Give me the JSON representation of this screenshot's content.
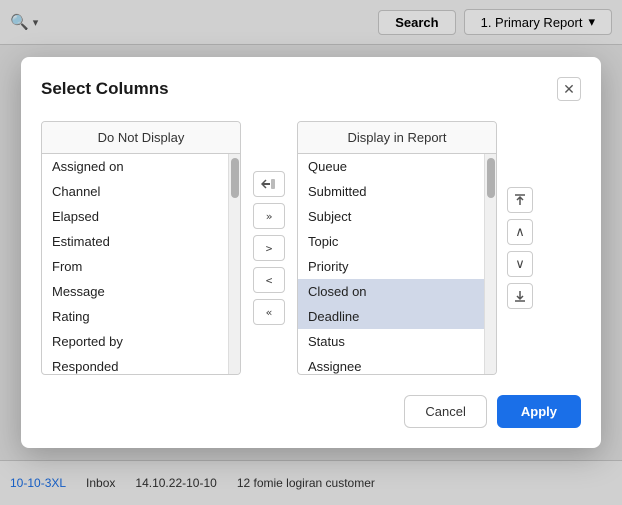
{
  "toolbar": {
    "search_label": "Search",
    "report_label": "1. Primary Report",
    "search_chevron": "⌄"
  },
  "bottom_bar": {
    "item1": "10-10-3XL",
    "item2": "Inbox",
    "item3": "14.10.22-10-10",
    "item4": "12 fomie logiran customer"
  },
  "modal": {
    "title": "Select Columns",
    "left_panel": {
      "header": "Do Not Display",
      "items": [
        {
          "label": "Assigned on",
          "selected": false
        },
        {
          "label": "Channel",
          "selected": false
        },
        {
          "label": "Elapsed",
          "selected": false
        },
        {
          "label": "Estimated",
          "selected": false
        },
        {
          "label": "From",
          "selected": false
        },
        {
          "label": "Message",
          "selected": false
        },
        {
          "label": "Rating",
          "selected": false
        },
        {
          "label": "Reported by",
          "selected": false
        },
        {
          "label": "Responded",
          "selected": false
        }
      ]
    },
    "right_panel": {
      "header": "Display in Report",
      "items": [
        {
          "label": "Queue",
          "selected": false
        },
        {
          "label": "Submitted",
          "selected": false
        },
        {
          "label": "Subject",
          "selected": false
        },
        {
          "label": "Topic",
          "selected": false
        },
        {
          "label": "Priority",
          "selected": false
        },
        {
          "label": "Closed on",
          "selected": true
        },
        {
          "label": "Deadline",
          "selected": true
        },
        {
          "label": "Status",
          "selected": false
        },
        {
          "label": "Assignee",
          "selected": false
        }
      ]
    },
    "transfer_buttons": [
      {
        "label": "↩",
        "name": "move-selected-left"
      },
      {
        "label": "»",
        "name": "move-all-right"
      },
      {
        "label": ">",
        "name": "move-selected-right"
      },
      {
        "label": "<",
        "name": "move-selected-left-single"
      },
      {
        "label": "«",
        "name": "move-all-left"
      }
    ],
    "right_controls": [
      {
        "label": "⇈",
        "name": "move-top"
      },
      {
        "label": "∧",
        "name": "move-up"
      },
      {
        "label": "∨",
        "name": "move-down"
      },
      {
        "label": "⇊",
        "name": "move-bottom"
      }
    ],
    "cancel_label": "Cancel",
    "apply_label": "Apply"
  }
}
